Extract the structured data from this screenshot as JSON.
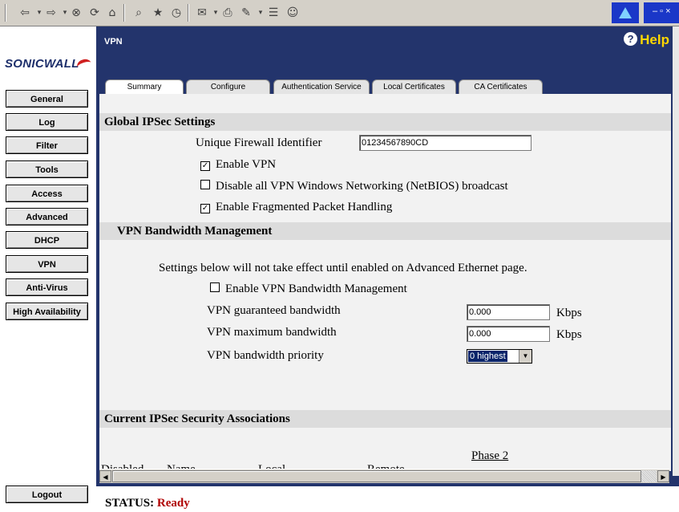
{
  "toolbar": {
    "icons": [
      "back-icon",
      "forward-icon",
      "stop-icon",
      "refresh-icon",
      "home-icon",
      "search-icon",
      "favorites-icon",
      "history-icon",
      "mail-icon",
      "print-icon",
      "edit-icon",
      "discuss-icon",
      "messenger-icon"
    ],
    "window_controls": "– ▫ ×"
  },
  "sidebar": {
    "logo_text": "SONICWALL",
    "items": [
      {
        "label": "General"
      },
      {
        "label": "Log"
      },
      {
        "label": "Filter"
      },
      {
        "label": "Tools"
      },
      {
        "label": "Access"
      },
      {
        "label": "Advanced"
      },
      {
        "label": "DHCP"
      },
      {
        "label": "VPN"
      },
      {
        "label": "Anti-Virus"
      },
      {
        "label": "High Availability"
      }
    ],
    "logout_label": "Logout"
  },
  "main": {
    "title": "VPN",
    "help_label": "Help",
    "tabs": [
      {
        "label": "Summary",
        "active": true
      },
      {
        "label": "Configure",
        "active": false
      },
      {
        "label": "Authentication Service",
        "active": false
      },
      {
        "label": "Local Certificates",
        "active": false
      },
      {
        "label": "CA Certificates",
        "active": false
      }
    ]
  },
  "global_ipsec": {
    "heading": "Global IPSec Settings",
    "firewall_id_label": "Unique Firewall Identifier",
    "firewall_id_value": "01234567890CD",
    "enable_vpn_label": "Enable VPN",
    "enable_vpn_checked": true,
    "disable_netbios_label": "Disable all VPN Windows Networking (NetBIOS) broadcast",
    "disable_netbios_checked": false,
    "frag_packet_label": "Enable Fragmented Packet Handling",
    "frag_packet_checked": true
  },
  "bandwidth": {
    "heading": "VPN Bandwidth Management",
    "note": "Settings below will not take effect until enabled on Advanced Ethernet page.",
    "enable_label": "Enable VPN Bandwidth Management",
    "enable_checked": false,
    "guaranteed_label": "VPN guaranteed bandwidth",
    "guaranteed_value": "0.000",
    "maximum_label": "VPN maximum bandwidth",
    "maximum_value": "0.000",
    "unit": "Kbps",
    "priority_label": "VPN bandwidth priority",
    "priority_value": "0 highest"
  },
  "associations": {
    "heading": "Current IPSec Security Associations",
    "columns": [
      "Disabled",
      "Name",
      "Local",
      "Remote",
      "Phase 2"
    ]
  },
  "status": {
    "label": "STATUS:",
    "value": "Ready"
  }
}
